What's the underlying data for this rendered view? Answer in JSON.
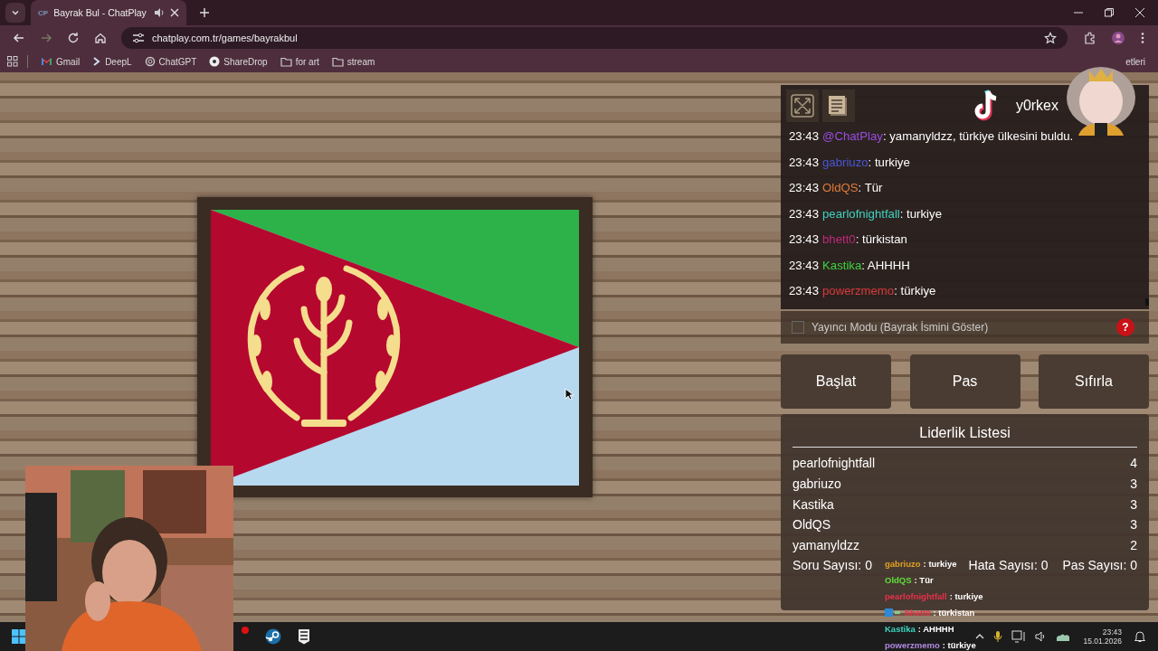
{
  "browser": {
    "tab": {
      "favicon": "CP",
      "title": "Bayrak Bul - ChatPlay"
    },
    "url": "chatplay.com.tr/games/bayrakbul",
    "bookmarks": [
      {
        "kind": "mail",
        "label": "Gmail"
      },
      {
        "kind": "deepl",
        "label": "DeepL"
      },
      {
        "kind": "knot",
        "label": "ChatGPT"
      },
      {
        "kind": "disc",
        "label": "ShareDrop"
      },
      {
        "kind": "folder",
        "label": "for art"
      },
      {
        "kind": "folder",
        "label": "stream"
      }
    ],
    "bookmarks_more": "etleri"
  },
  "channel": {
    "name": "y0rkex"
  },
  "chat": [
    {
      "time": "23:43",
      "user": "@ChatPlay",
      "color": "#9b4de0",
      "text": ": yamanyldzz, türkiye ülkesini buldu."
    },
    {
      "time": "23:43",
      "user": "gabriuzo",
      "color": "#4a55d8",
      "text": ": turkiye"
    },
    {
      "time": "23:43",
      "user": "OldQS",
      "color": "#e07a3a",
      "text": ": Tür"
    },
    {
      "time": "23:43",
      "user": "pearlofnightfall",
      "color": "#3fd3c0",
      "text": ": turkiye"
    },
    {
      "time": "23:43",
      "user": "bhett0",
      "color": "#c0287a",
      "text": ": türkistan"
    },
    {
      "time": "23:43",
      "user": "Kastika",
      "color": "#3ed23e",
      "text": ": AHHHH"
    },
    {
      "time": "23:43",
      "user": "powerzmemo",
      "color": "#d83a3a",
      "text": ": türkiye"
    }
  ],
  "streamer_mode": {
    "label": "Yayıncı Modu (Bayrak İsmini Göster)",
    "checked": false,
    "help": "?"
  },
  "buttons": [
    "Başlat",
    "Pas",
    "Sıfırla"
  ],
  "leaderboard": {
    "title": "Liderlik Listesi",
    "rows": [
      {
        "name": "pearlofnightfall",
        "score": "4"
      },
      {
        "name": "gabriuzo",
        "score": "3"
      },
      {
        "name": "Kastika",
        "score": "3"
      },
      {
        "name": "OldQS",
        "score": "3"
      },
      {
        "name": "yamanyldzz",
        "score": "2"
      }
    ],
    "stats": [
      "Soru Sayısı: 0",
      "Hata Sayısı: 0",
      "Pas Sayısı: 0"
    ]
  },
  "stream_chat": [
    {
      "user": "gabriuzo",
      "color": "#e0a020",
      "text": ": turkiye",
      "badges": false
    },
    {
      "user": "OldQS",
      "color": "#5ee03a",
      "text": ": Tür",
      "badges": false
    },
    {
      "user": "pearlofnightfall",
      "color": "#e8304a",
      "text": ": turkiye",
      "badges": false
    },
    {
      "user": "bhett0",
      "color": "#e8304a",
      "text": ": türkistan",
      "badges": true
    },
    {
      "user": "Kastika",
      "color": "#3ad6c0",
      "text": ": AHHHH",
      "badges": false
    },
    {
      "user": "powerzmemo",
      "color": "#b08ae0",
      "text": ": türkiye",
      "badges": false
    }
  ],
  "taskbar": {
    "time": "23:43",
    "date": "15.01.2026"
  }
}
